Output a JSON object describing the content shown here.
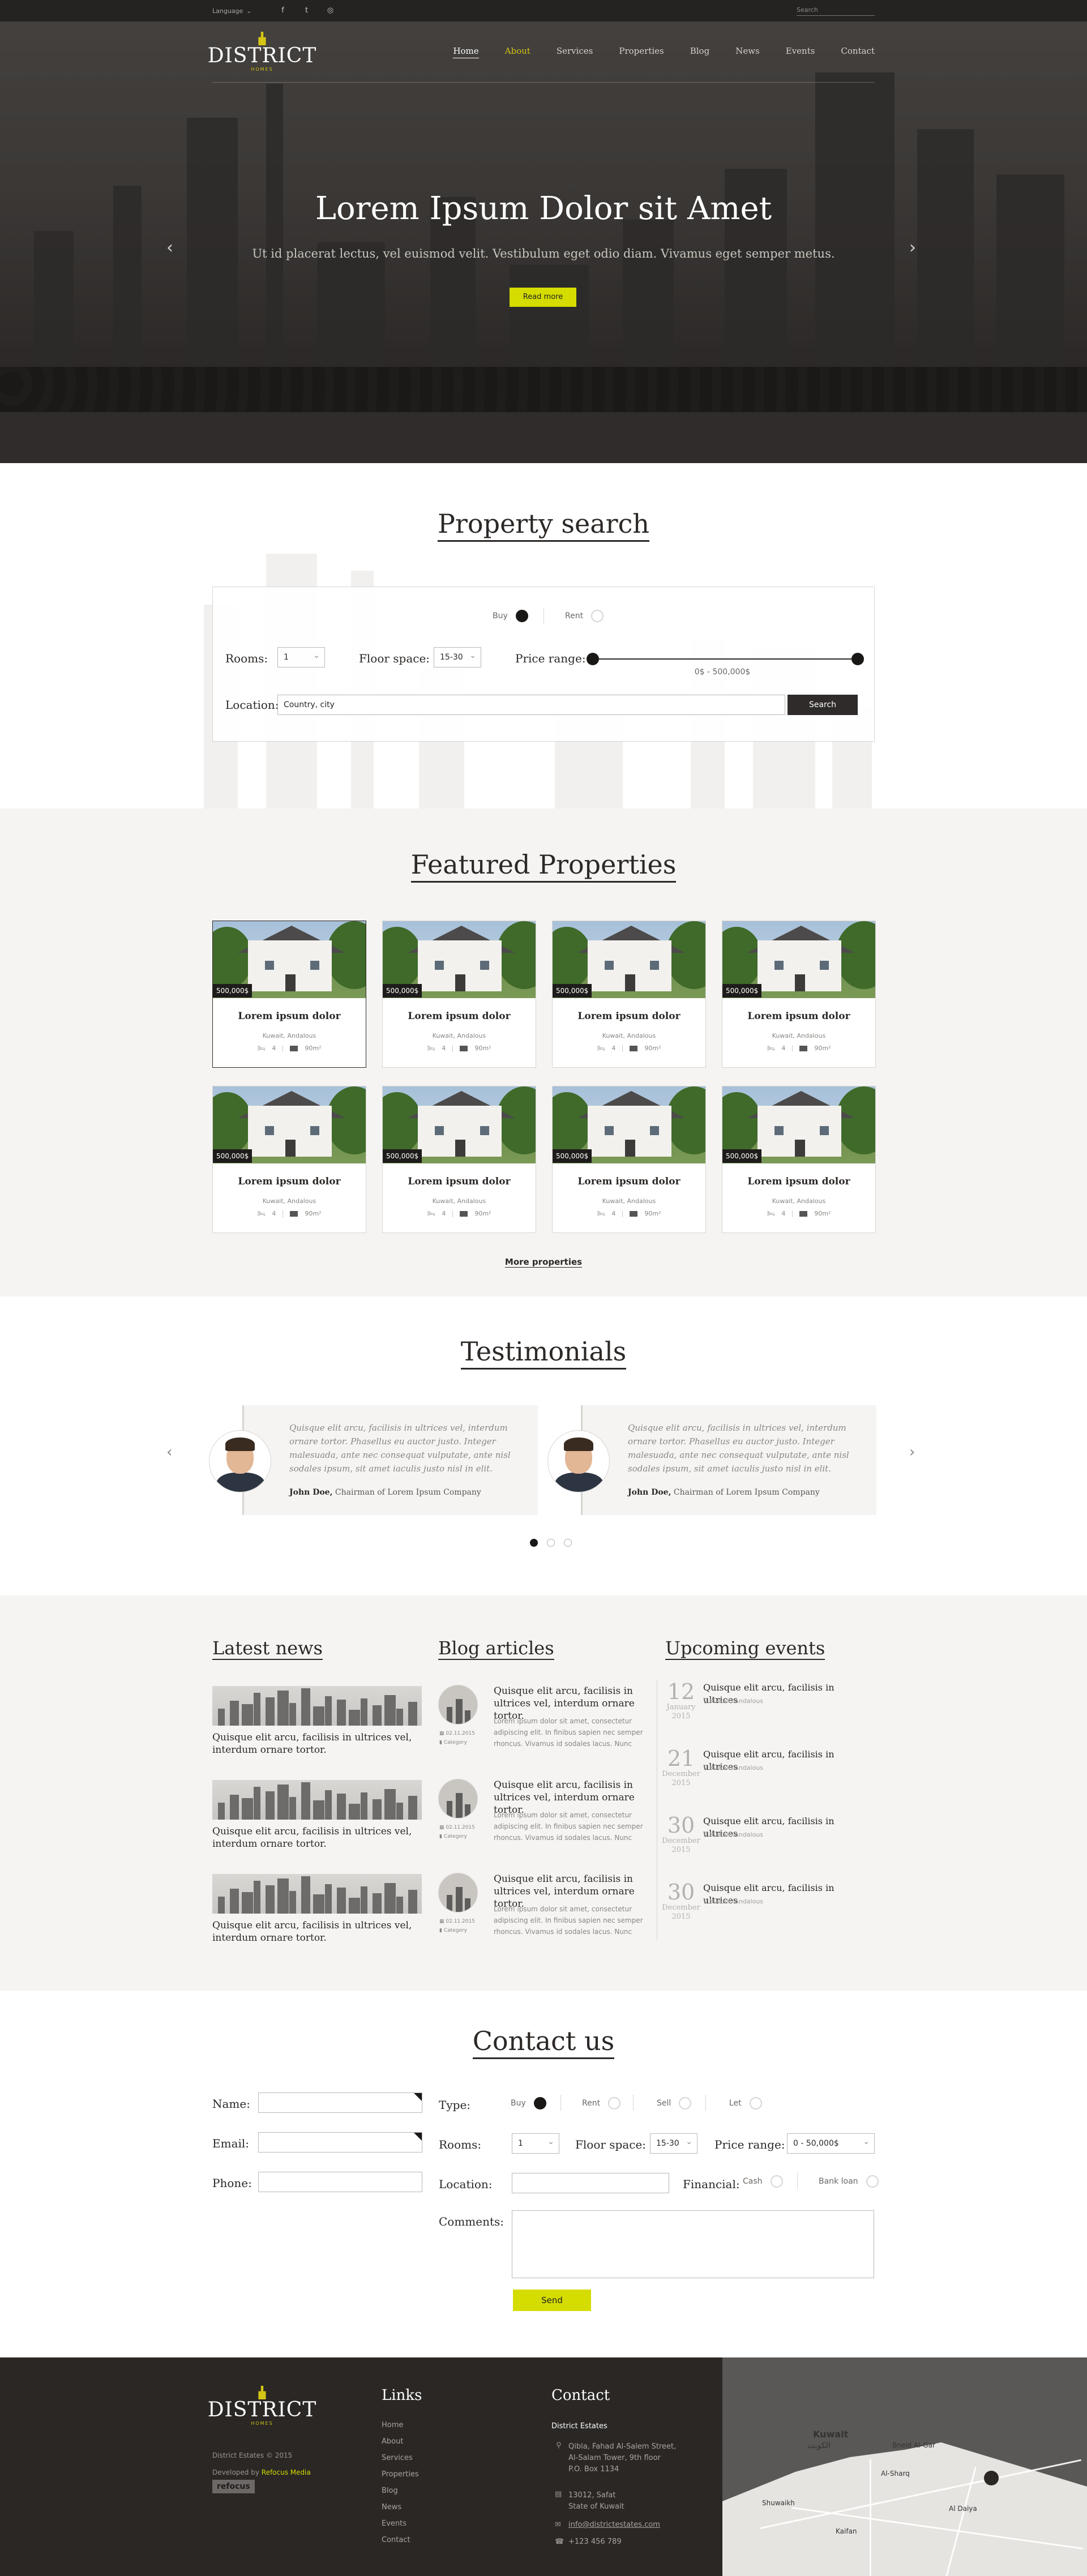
{
  "topbar": {
    "language_label": "Language",
    "language_arrow": "⌄",
    "social": [
      {
        "icon": "facebook-icon",
        "glyph": "f"
      },
      {
        "icon": "twitter-icon",
        "glyph": "t"
      },
      {
        "icon": "instagram-icon",
        "glyph": "◎"
      }
    ],
    "search_placeholder": "Search"
  },
  "brand": {
    "name": "DISTRICT",
    "tagline": "HOMES"
  },
  "nav": {
    "items": [
      "Home",
      "About",
      "Services",
      "Properties",
      "Blog",
      "News",
      "Events",
      "Contact"
    ]
  },
  "hero": {
    "title": "Lorem Ipsum Dolor sit Amet",
    "subtitle": "Ut id placerat lectus, vel euismod velit. Vestibulum eget odio diam. Vivamus eget semper metus.",
    "button": "Read more",
    "prev": "‹",
    "next": "›"
  },
  "property_search": {
    "title": "Property search",
    "buy_label": "Buy",
    "rent_label": "Rent",
    "rooms_label": "Rooms:",
    "rooms_value": "1",
    "floor_label": "Floor space:",
    "floor_value": "15-30",
    "price_label": "Price range:",
    "price_value": "0$ - 500,000$",
    "location_label": "Location:",
    "location_value": "Country, city",
    "search_button": "Search"
  },
  "featured": {
    "title": "Featured Properties",
    "cards": [
      {
        "price": "500,000$",
        "title": "Lorem ipsum dolor",
        "location": "Kuwait, Andalous",
        "beds": "4",
        "area": "90m²"
      },
      {
        "price": "500,000$",
        "title": "Lorem ipsum dolor",
        "location": "Kuwait, Andalous",
        "beds": "4",
        "area": "90m²"
      },
      {
        "price": "500,000$",
        "title": "Lorem ipsum dolor",
        "location": "Kuwait, Andalous",
        "beds": "4",
        "area": "90m²"
      },
      {
        "price": "500,000$",
        "title": "Lorem ipsum dolor",
        "location": "Kuwait, Andalous",
        "beds": "4",
        "area": "90m²"
      },
      {
        "price": "500,000$",
        "title": "Lorem ipsum dolor",
        "location": "Kuwait, Andalous",
        "beds": "4",
        "area": "90m²"
      },
      {
        "price": "500,000$",
        "title": "Lorem ipsum dolor",
        "location": "Kuwait, Andalous",
        "beds": "4",
        "area": "90m²"
      },
      {
        "price": "500,000$",
        "title": "Lorem ipsum dolor",
        "location": "Kuwait, Andalous",
        "beds": "4",
        "area": "90m²"
      },
      {
        "price": "500,000$",
        "title": "Lorem ipsum dolor",
        "location": "Kuwait, Andalous",
        "beds": "4",
        "area": "90m²"
      }
    ],
    "more": "More properties"
  },
  "testimonials": {
    "title": "Testimonials",
    "items": [
      {
        "quote": "Quisque elit arcu, facilisis in ultrices vel, interdum ornare tortor. Phasellus eu auctor justo. Integer malesuada, ante nec consequat vulputate, ante nisl sodales ipsum, sit amet iaculis justo nisl in elit.",
        "name": "John Doe,",
        "role": "Chairman of Lorem Ipsum Company"
      },
      {
        "quote": "Quisque elit arcu, facilisis in ultrices vel, interdum ornare tortor. Phasellus eu auctor justo. Integer malesuada, ante nec consequat vulputate, ante nisl sodales ipsum, sit amet iaculis justo nisl in elit.",
        "name": "John Doe,",
        "role": "Chairman of Lorem Ipsum Company"
      }
    ],
    "prev": "‹",
    "next": "›"
  },
  "news": {
    "title": "Latest news",
    "items": [
      {
        "title": "Quisque elit arcu, facilisis in ultrices vel, interdum ornare tortor."
      },
      {
        "title": "Quisque elit arcu, facilisis in ultrices vel, interdum ornare tortor."
      },
      {
        "title": "Quisque elit arcu, facilisis in ultrices vel, interdum ornare tortor."
      }
    ]
  },
  "blog": {
    "title": "Blog articles",
    "items": [
      {
        "title": "Quisque elit arcu, facilisis in ultrices vel, interdum ornare tortor.",
        "date": "02.11.2015",
        "category": "Category",
        "text": "Lorem ipsum dolor sit amet, consectetur adipiscing elit. In finibus sapien nec semper rhoncus. Vivamus id sodales lacus. Nunc"
      },
      {
        "title": "Quisque elit arcu, facilisis in ultrices vel, interdum ornare tortor.",
        "date": "02.11.2015",
        "category": "Category",
        "text": "Lorem ipsum dolor sit amet, consectetur adipiscing elit. In finibus sapien nec semper rhoncus. Vivamus id sodales lacus. Nunc"
      },
      {
        "title": "Quisque elit arcu, facilisis in ultrices vel, interdum ornare tortor.",
        "date": "02.11.2015",
        "category": "Category",
        "text": "Lorem ipsum dolor sit amet, consectetur adipiscing elit. In finibus sapien nec semper rhoncus. Vivamus id sodales lacus. Nunc"
      }
    ]
  },
  "events": {
    "title": "Upcoming events",
    "items": [
      {
        "day": "12",
        "month": "January",
        "year": "2015",
        "title": "Quisque elit arcu, facilisis in ultrices",
        "location": "Kuwait, Andalous"
      },
      {
        "day": "21",
        "month": "December",
        "year": "2015",
        "title": "Quisque elit arcu, facilisis in ultrices",
        "location": "Kuwait, Andalous"
      },
      {
        "day": "30",
        "month": "December",
        "year": "2015",
        "title": "Quisque elit arcu, facilisis in ultrices",
        "location": "Kuwait, Andalous"
      },
      {
        "day": "30",
        "month": "December",
        "year": "2015",
        "title": "Quisque elit arcu, facilisis in ultrices",
        "location": "Kuwait, Andalous"
      }
    ]
  },
  "contact": {
    "title": "Contact us",
    "name_label": "Name:",
    "email_label": "Email:",
    "phone_label": "Phone:",
    "type_label": "Type:",
    "types": [
      "Buy",
      "Rent",
      "Sell",
      "Let"
    ],
    "rooms_label": "Rooms:",
    "rooms_value": "1",
    "floor_label": "Floor space:",
    "floor_value": "15-30",
    "price_label": "Price range:",
    "price_value": "0 - 50,000$",
    "location_label": "Location:",
    "financial_label": "Financial:",
    "financial_options": [
      "Cash",
      "Bank loan"
    ],
    "comments_label": "Comments:",
    "send": "Send"
  },
  "footer": {
    "copyright": "District Estates © 2015",
    "developed_by": "Developed by",
    "developer": "Refocus Media",
    "badge": "refocus",
    "links_title": "Links",
    "links": [
      "Home",
      "About",
      "Services",
      "Properties",
      "Blog",
      "News",
      "Events",
      "Contact"
    ],
    "contact_title": "Contact",
    "company": "District Estates",
    "address1": "Qibla, Fahad Al-Salem Street,",
    "address2": "Al-Salam Tower, 9th floor",
    "address3": "P.O. Box 1134",
    "postal1": "13012, Safat",
    "postal2": "State of Kuwait",
    "email": "info@districtestates.com",
    "phone": "+123 456 789",
    "map_city": "Kuwait",
    "map_city_ar": "الكويت",
    "map_area1": "Bneid Al-Gar",
    "map_area2": "Al-Sharq",
    "map_area3": "Kaifan",
    "map_area4": "Shuwaikh",
    "map_area5": "Al Daiya"
  },
  "colors": {
    "accent": "#d4dc00",
    "dark": "#2a2725",
    "light_bg": "#f5f4f2"
  }
}
